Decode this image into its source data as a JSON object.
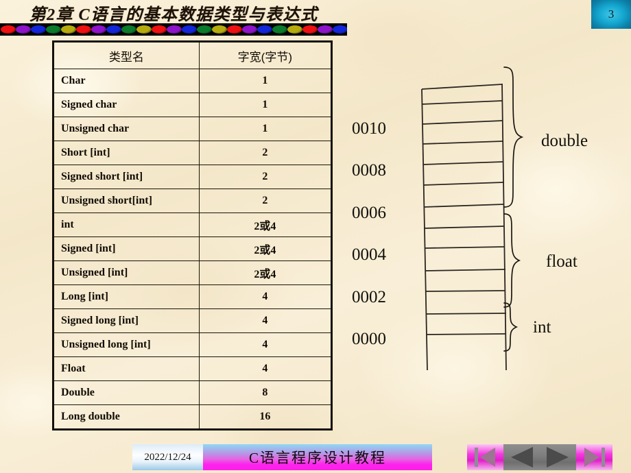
{
  "slide": {
    "title": "第2章 C语言的基本数据类型与表达式",
    "page_number": "3",
    "background_color": "#f7ebd0"
  },
  "bead_bar": {
    "colors": [
      "#ee1111",
      "#8d14c9",
      "#1326d8",
      "#0b7a2a",
      "#b5ab0e"
    ],
    "bead_count": 23,
    "bar_color": "#000000"
  },
  "table": {
    "headers": [
      "类型名",
      "字宽(字节)"
    ],
    "rows": [
      {
        "name": "Char",
        "width": "1"
      },
      {
        "name": "Signed char",
        "width": "1"
      },
      {
        "name": "Unsigned char",
        "width": "1"
      },
      {
        "name": "Short [int]",
        "width": "2"
      },
      {
        "name": "Signed short [int]",
        "width": "2"
      },
      {
        "name": "Unsigned short[int]",
        "width": "2"
      },
      {
        "name": "int",
        "width": "2或4"
      },
      {
        "name": "Signed [int]",
        "width": "2或4"
      },
      {
        "name": "Unsigned [int]",
        "width": "2或4"
      },
      {
        "name": "Long [int]",
        "width": "4"
      },
      {
        "name": "Signed long [int]",
        "width": "4"
      },
      {
        "name": "Unsigned long [int]",
        "width": "4"
      },
      {
        "name": "Float",
        "width": "4"
      },
      {
        "name": "Double",
        "width": "8"
      },
      {
        "name": "Long double",
        "width": "16"
      }
    ]
  },
  "memory_diagram": {
    "address_labels": [
      "0010",
      "0008",
      "0006",
      "0004",
      "0002",
      "0000"
    ],
    "type_labels": [
      "double",
      "float",
      "int"
    ],
    "cell_count": 14,
    "line_color": "#2a2620"
  },
  "footer": {
    "date": "2022/12/24",
    "subtitle": "C语言程序设计教程"
  },
  "nav_buttons": [
    {
      "name": "first-slide",
      "icon": "first-icon"
    },
    {
      "name": "previous-slide",
      "icon": "previous-icon"
    },
    {
      "name": "next-slide",
      "icon": "next-icon"
    },
    {
      "name": "last-slide",
      "icon": "last-icon"
    }
  ]
}
